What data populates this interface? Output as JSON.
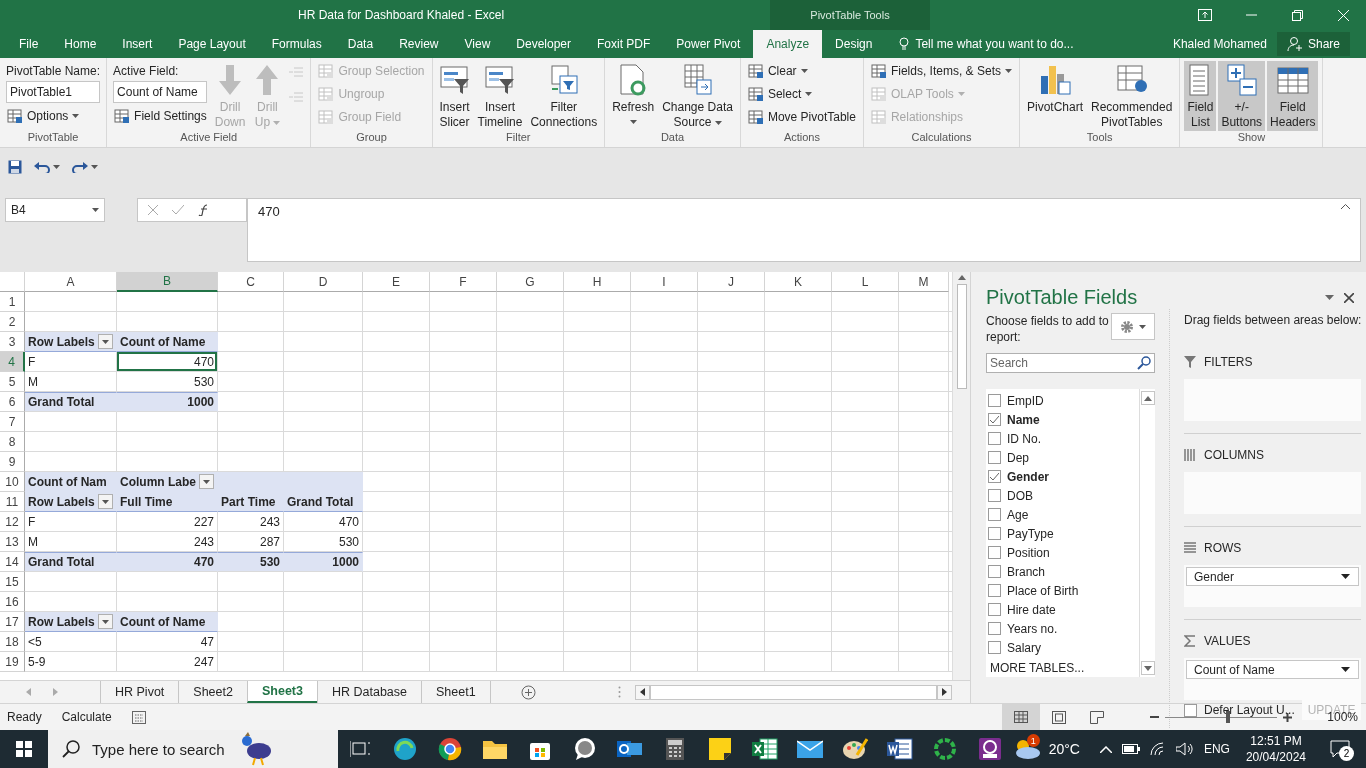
{
  "window": {
    "title": "HR Data for Dashboard Khaled - Excel",
    "context_title": "PivotTable Tools"
  },
  "tabs": [
    {
      "label": "File",
      "selected": false
    },
    {
      "label": "Home",
      "selected": false
    },
    {
      "label": "Insert",
      "selected": false
    },
    {
      "label": "Page Layout",
      "selected": false
    },
    {
      "label": "Formulas",
      "selected": false
    },
    {
      "label": "Data",
      "selected": false
    },
    {
      "label": "Review",
      "selected": false
    },
    {
      "label": "View",
      "selected": false
    },
    {
      "label": "Developer",
      "selected": false
    },
    {
      "label": "Foxit PDF",
      "selected": false
    },
    {
      "label": "Power Pivot",
      "selected": false
    },
    {
      "label": "Analyze",
      "selected": true
    },
    {
      "label": "Design",
      "selected": false
    }
  ],
  "tell_me": {
    "placeholder": "Tell me what you want to do..."
  },
  "user": "Khaled Mohamed",
  "share": "Share",
  "ribbon": {
    "groups": [
      {
        "label": "PivotTable",
        "columns": [
          [
            {
              "kind": "caption",
              "text": "PivotTable Name:"
            },
            {
              "kind": "field",
              "value": "PivotTable1"
            },
            {
              "kind": "small",
              "label": "Options",
              "dropdown": true,
              "disabled": false
            }
          ]
        ]
      },
      {
        "label": "Active Field",
        "columns": [
          [
            {
              "kind": "caption",
              "text": "Active Field:"
            },
            {
              "kind": "field",
              "value": "Count of Name"
            },
            {
              "kind": "small",
              "label": "Field Settings",
              "dropdown": false,
              "disabled": false
            }
          ],
          [
            {
              "kind": "big",
              "lines": [
                "Drill",
                "Down"
              ],
              "dropdown": false,
              "disabled": true
            }
          ],
          [
            {
              "kind": "big",
              "lines": [
                "Drill",
                "Up"
              ],
              "dropdown": true,
              "disabled": true
            }
          ],
          [
            {
              "kind": "tiny",
              "disabled": true
            },
            {
              "kind": "tiny",
              "disabled": true
            }
          ]
        ]
      },
      {
        "label": "Group",
        "columns": [
          [
            {
              "kind": "small",
              "label": "Group Selection",
              "dropdown": false,
              "disabled": true
            },
            {
              "kind": "small",
              "label": "Ungroup",
              "dropdown": false,
              "disabled": true
            },
            {
              "kind": "small",
              "label": "Group Field",
              "dropdown": false,
              "disabled": true
            }
          ]
        ]
      },
      {
        "label": "Filter",
        "columns": [
          [
            {
              "kind": "big",
              "lines": [
                "Insert",
                "Slicer"
              ],
              "dropdown": false,
              "disabled": false
            }
          ],
          [
            {
              "kind": "big",
              "lines": [
                "Insert",
                "Timeline"
              ],
              "dropdown": false,
              "disabled": false
            }
          ],
          [
            {
              "kind": "big",
              "lines": [
                "Filter",
                "Connections"
              ],
              "dropdown": false,
              "disabled": false
            }
          ]
        ]
      },
      {
        "label": "Data",
        "columns": [
          [
            {
              "kind": "big",
              "lines": [
                "Refresh"
              ],
              "dropdown": true,
              "disabled": false
            }
          ],
          [
            {
              "kind": "big",
              "lines": [
                "Change Data",
                "Source"
              ],
              "dropdown": true,
              "disabled": false
            }
          ]
        ]
      },
      {
        "label": "Actions",
        "columns": [
          [
            {
              "kind": "small",
              "label": "Clear",
              "dropdown": true,
              "disabled": false
            },
            {
              "kind": "small",
              "label": "Select",
              "dropdown": true,
              "disabled": false
            },
            {
              "kind": "small",
              "label": "Move PivotTable",
              "dropdown": false,
              "disabled": false
            }
          ]
        ]
      },
      {
        "label": "Calculations",
        "columns": [
          [
            {
              "kind": "small",
              "label": "Fields, Items, & Sets",
              "dropdown": true,
              "disabled": false
            },
            {
              "kind": "small",
              "label": "OLAP Tools",
              "dropdown": true,
              "disabled": true
            },
            {
              "kind": "small",
              "label": "Relationships",
              "dropdown": false,
              "disabled": true
            }
          ]
        ]
      },
      {
        "label": "Tools",
        "columns": [
          [
            {
              "kind": "big",
              "lines": [
                "PivotChart"
              ],
              "dropdown": false,
              "disabled": false
            }
          ],
          [
            {
              "kind": "big",
              "lines": [
                "Recommended",
                "PivotTables"
              ],
              "dropdown": false,
              "disabled": false
            }
          ]
        ]
      },
      {
        "label": "Show",
        "columns": [
          [
            {
              "kind": "big",
              "lines": [
                "Field",
                "List"
              ],
              "dropdown": false,
              "disabled": false,
              "on": true
            }
          ],
          [
            {
              "kind": "big",
              "lines": [
                "+/-",
                "Buttons"
              ],
              "dropdown": false,
              "disabled": false,
              "on": true
            }
          ],
          [
            {
              "kind": "big",
              "lines": [
                "Field",
                "Headers"
              ],
              "dropdown": false,
              "disabled": false,
              "on": true
            }
          ]
        ]
      }
    ]
  },
  "formula_bar": {
    "name_box": "B4",
    "formula": "470"
  },
  "sheet": {
    "columns": [
      {
        "label": "A",
        "selected": false
      },
      {
        "label": "B",
        "selected": true
      },
      {
        "label": "C",
        "selected": false
      },
      {
        "label": "D",
        "selected": false
      },
      {
        "label": "E",
        "selected": false
      },
      {
        "label": "F",
        "selected": false
      },
      {
        "label": "G",
        "selected": false
      },
      {
        "label": "H",
        "selected": false
      },
      {
        "label": "I",
        "selected": false
      },
      {
        "label": "J",
        "selected": false
      },
      {
        "label": "K",
        "selected": false
      },
      {
        "label": "L",
        "selected": false
      },
      {
        "label": "M",
        "selected": false
      }
    ],
    "rows": [
      {
        "label": "1",
        "selected": false
      },
      {
        "label": "2",
        "selected": false
      },
      {
        "label": "3",
        "selected": false,
        "cells": [
          {
            "text": "Row Labels",
            "kind": "header",
            "filter": true,
            "selected": false
          },
          {
            "text": "Count of Name",
            "kind": "header",
            "filter": false,
            "selected": false
          }
        ]
      },
      {
        "label": "4",
        "selected": true,
        "cells": [
          {
            "text": "F",
            "kind": "body_label",
            "filter": false,
            "selected": false
          },
          {
            "text": "470",
            "kind": "body_number",
            "filter": false,
            "selected": true
          }
        ]
      },
      {
        "label": "5",
        "selected": false,
        "cells": [
          {
            "text": "M",
            "kind": "body_label",
            "filter": false,
            "selected": false
          },
          {
            "text": "530",
            "kind": "body_number",
            "filter": false,
            "selected": false
          }
        ]
      },
      {
        "label": "6",
        "selected": false,
        "cells": [
          {
            "text": "Grand Total",
            "kind": "total_label",
            "filter": false,
            "selected": false
          },
          {
            "text": "1000",
            "kind": "total_number",
            "filter": false,
            "selected": false
          }
        ]
      },
      {
        "label": "7",
        "selected": false
      },
      {
        "label": "8",
        "selected": false
      },
      {
        "label": "9",
        "selected": false
      },
      {
        "label": "10",
        "selected": false,
        "cells": [
          {
            "text": "Count of Nam",
            "kind": "caption",
            "filter": false,
            "selected": false
          },
          {
            "text": "Column Labe",
            "kind": "caption",
            "filter": true,
            "selected": false
          },
          {
            "kind": "caption",
            "filter": false,
            "selected": false
          },
          {
            "kind": "caption",
            "filter": false,
            "selected": false
          }
        ]
      },
      {
        "label": "11",
        "selected": false,
        "cells": [
          {
            "text": "Row Labels",
            "kind": "header",
            "filter": true,
            "selected": false
          },
          {
            "text": "Full Time",
            "kind": "header",
            "filter": false,
            "selected": false
          },
          {
            "text": "Part Time",
            "kind": "header",
            "filter": false,
            "selected": false
          },
          {
            "text": "Grand Total",
            "kind": "header",
            "filter": false,
            "selected": false
          }
        ]
      },
      {
        "label": "12",
        "selected": false,
        "cells": [
          {
            "text": "F",
            "kind": "body_label",
            "filter": false,
            "selected": false
          },
          {
            "text": "227",
            "kind": "body_number",
            "filter": false,
            "selected": false
          },
          {
            "text": "243",
            "kind": "body_number",
            "filter": false,
            "selected": false
          },
          {
            "text": "470",
            "kind": "body_number",
            "filter": false,
            "selected": false
          }
        ]
      },
      {
        "label": "13",
        "selected": false,
        "cells": [
          {
            "text": "M",
            "kind": "body_label",
            "filter": false,
            "selected": false
          },
          {
            "text": "243",
            "kind": "body_number",
            "filter": false,
            "selected": false
          },
          {
            "text": "287",
            "kind": "body_number",
            "filter": false,
            "selected": false
          },
          {
            "text": "530",
            "kind": "body_number",
            "filter": false,
            "selected": false
          }
        ]
      },
      {
        "label": "14",
        "selected": false,
        "cells": [
          {
            "text": "Grand Total",
            "kind": "total_label",
            "filter": false,
            "selected": false
          },
          {
            "text": "470",
            "kind": "total_number",
            "filter": false,
            "selected": false
          },
          {
            "text": "530",
            "kind": "total_number",
            "filter": false,
            "selected": false
          },
          {
            "text": "1000",
            "kind": "total_number",
            "filter": false,
            "selected": false
          }
        ]
      },
      {
        "label": "15",
        "selected": false
      },
      {
        "label": "16",
        "selected": false
      },
      {
        "label": "17",
        "selected": false,
        "cells": [
          {
            "text": "Row Labels",
            "kind": "header",
            "filter": true,
            "selected": false
          },
          {
            "text": "Count of Name",
            "kind": "header",
            "filter": false,
            "selected": false
          }
        ]
      },
      {
        "label": "18",
        "selected": false,
        "cells": [
          {
            "text": "<5",
            "kind": "body_label",
            "filter": false,
            "selected": false
          },
          {
            "text": "47",
            "kind": "body_number",
            "filter": false,
            "selected": false
          }
        ]
      },
      {
        "label": "19",
        "selected": false,
        "cells": [
          {
            "text": "5-9",
            "kind": "body_label",
            "filter": false,
            "selected": false
          },
          {
            "text": "247",
            "kind": "body_number",
            "filter": false,
            "selected": false
          }
        ]
      }
    ]
  },
  "sheet_tabs": [
    {
      "label": "HR Pivot",
      "selected": false
    },
    {
      "label": "Sheet2",
      "selected": false
    },
    {
      "label": "Sheet3",
      "selected": true
    },
    {
      "label": "HR Database",
      "selected": false
    },
    {
      "label": "Sheet1",
      "selected": false
    }
  ],
  "pivot_pane": {
    "title": "PivotTable Fields",
    "prompt": "Choose fields to add to report:",
    "search": {
      "placeholder": "Search"
    },
    "fields": [
      {
        "name": "EmpID",
        "checked": false
      },
      {
        "name": "Name",
        "checked": true
      },
      {
        "name": "ID No.",
        "checked": false
      },
      {
        "name": "Dep",
        "checked": false
      },
      {
        "name": "Gender",
        "checked": true
      },
      {
        "name": "DOB",
        "checked": false
      },
      {
        "name": "Age",
        "checked": false
      },
      {
        "name": "PayType",
        "checked": false
      },
      {
        "name": "Position",
        "checked": false
      },
      {
        "name": "Branch",
        "checked": false
      },
      {
        "name": "Place of Birth",
        "checked": false
      },
      {
        "name": "Hire date",
        "checked": false
      },
      {
        "name": "Years no.",
        "checked": false
      },
      {
        "name": "Salary",
        "checked": false
      }
    ],
    "more_tables": "MORE TABLES...",
    "areas_hint": "Drag fields between areas below:",
    "areas": [
      {
        "kind": "filters",
        "label": "FILTERS"
      },
      {
        "kind": "columns",
        "label": "COLUMNS"
      },
      {
        "kind": "rows",
        "label": "ROWS",
        "items": [
          "Gender"
        ]
      },
      {
        "kind": "values",
        "label": "VALUES",
        "items": [
          "Count of Name"
        ]
      }
    ],
    "defer": {
      "label": "Defer Layout U...",
      "checked": false
    },
    "update": {
      "label": "UPDATE",
      "disabled": true
    }
  },
  "status_bar": {
    "mode": "Ready",
    "calc": "Calculate",
    "views": [
      {
        "selected": true
      },
      {
        "selected": false
      },
      {
        "selected": false
      }
    ],
    "zoom": {
      "level": 0.56,
      "reading": "100%"
    }
  },
  "taskbar": {
    "search": {
      "placeholder": "Type here to search"
    },
    "weather": {
      "temperature": "20°C",
      "badge": "1"
    },
    "language": "ENG",
    "time": "12:51 PM",
    "date": "20/04/2024",
    "notifications": "2"
  }
}
